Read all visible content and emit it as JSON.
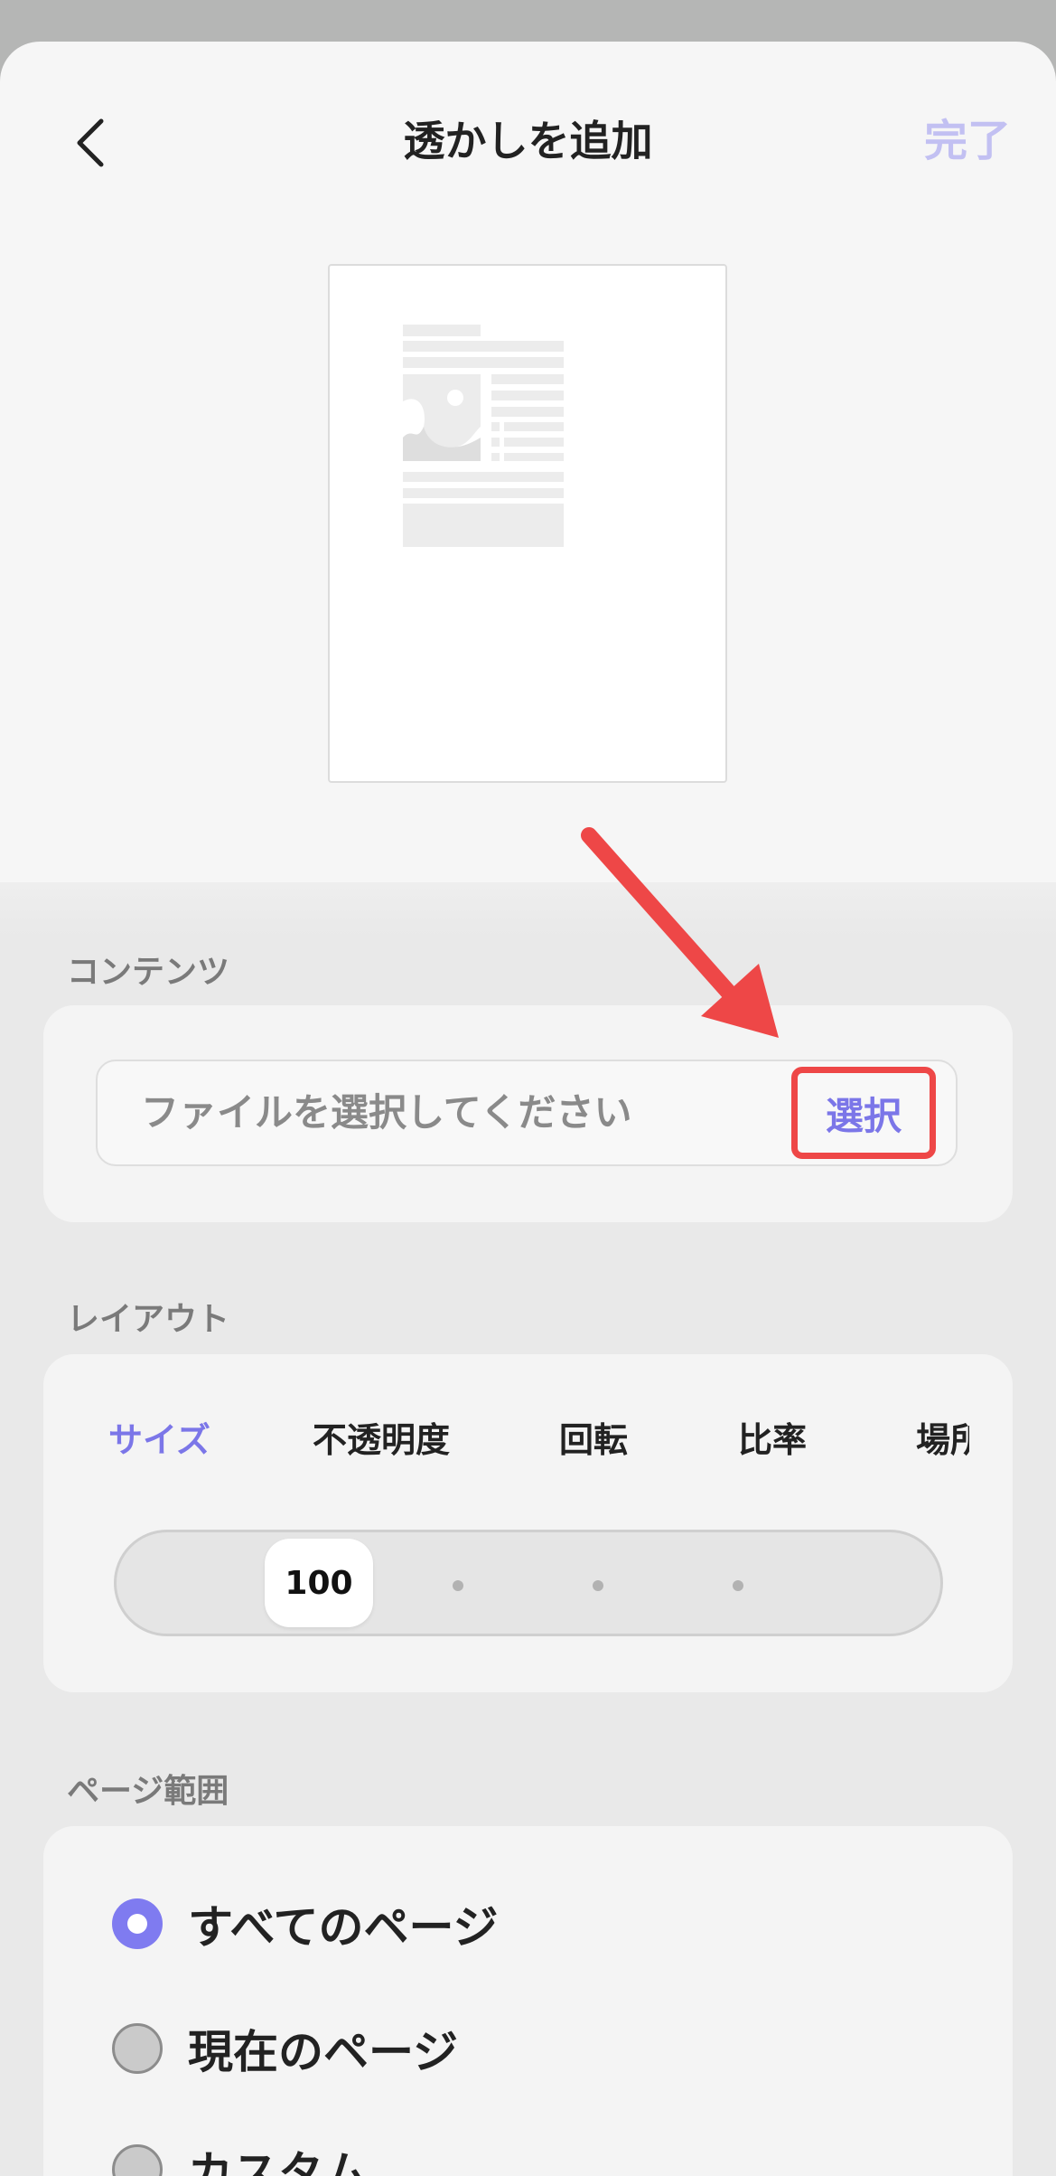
{
  "header": {
    "title": "透かしを追加",
    "done_label": "完了"
  },
  "content_section": {
    "label": "コンテンツ",
    "file_placeholder": "ファイルを選択してください",
    "select_label": "選択"
  },
  "layout_section": {
    "label": "レイアウト",
    "tabs": [
      {
        "label": "サイズ",
        "active": true
      },
      {
        "label": "不透明度",
        "active": false
      },
      {
        "label": "回転",
        "active": false
      },
      {
        "label": "比率",
        "active": false
      },
      {
        "label": "場所",
        "active": false
      }
    ],
    "slider_value": "100"
  },
  "page_range_section": {
    "label": "ページ範囲",
    "options": [
      {
        "label": "すべてのページ",
        "selected": true
      },
      {
        "label": "現在のページ",
        "selected": false
      },
      {
        "label": "カスタム",
        "selected": false
      }
    ]
  },
  "colors": {
    "accent": "#7b76e8",
    "highlight": "#ee4747",
    "done_disabled": "#c2c0f2"
  }
}
